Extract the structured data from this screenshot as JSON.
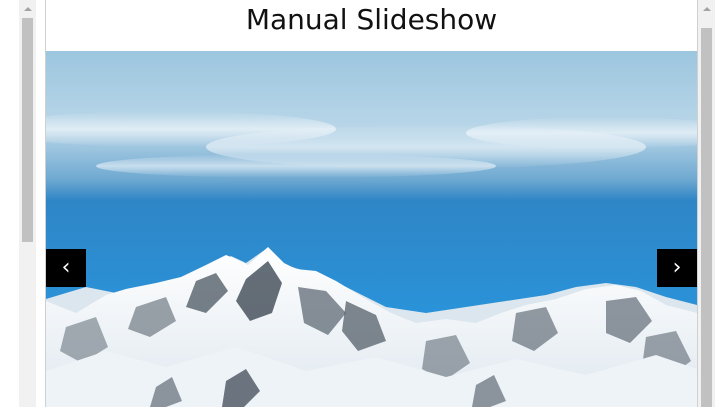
{
  "page": {
    "title": "Manual Slideshow"
  },
  "slideshow": {
    "prev_label": "‹",
    "next_label": "›",
    "slide_image": "snowy-mountains-photo"
  },
  "colors": {
    "sky_top": "#8fbdd9",
    "sky_mid": "#2f8fcf",
    "sky_bottom": "#2a93d9",
    "snow": "#f4f7fa",
    "rock": "#4a5560",
    "nav_bg": "#000000",
    "nav_fg": "#ffffff"
  }
}
